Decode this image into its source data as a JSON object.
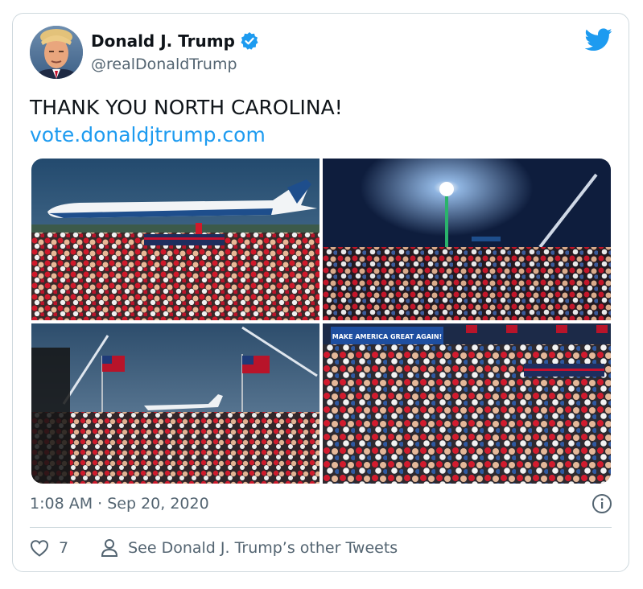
{
  "author": {
    "name": "Donald J. Trump",
    "handle": "@realDonaldTrump",
    "verified": true
  },
  "tweet": {
    "text": "THANK YOU NORTH CAROLINA!",
    "link": "vote.donaldjtrump.com",
    "timestamp": "1:08 AM · Sep 20, 2020"
  },
  "photos": [
    {
      "banner": ""
    },
    {
      "banner": ""
    },
    {
      "banner": ""
    },
    {
      "banner": "MAKE AMERICA GREAT AGAIN!"
    }
  ],
  "actions": {
    "likes": "7",
    "other_tweets": "See Donald J. Trump’s other Tweets"
  },
  "colors": {
    "accent": "#1d9bf0",
    "secondary_text": "#536471",
    "border": "#cfd9de",
    "heart": "#f91880"
  },
  "icons": [
    "verified-badge-icon",
    "twitter-bird-icon",
    "info-icon",
    "heart-icon",
    "person-icon"
  ]
}
